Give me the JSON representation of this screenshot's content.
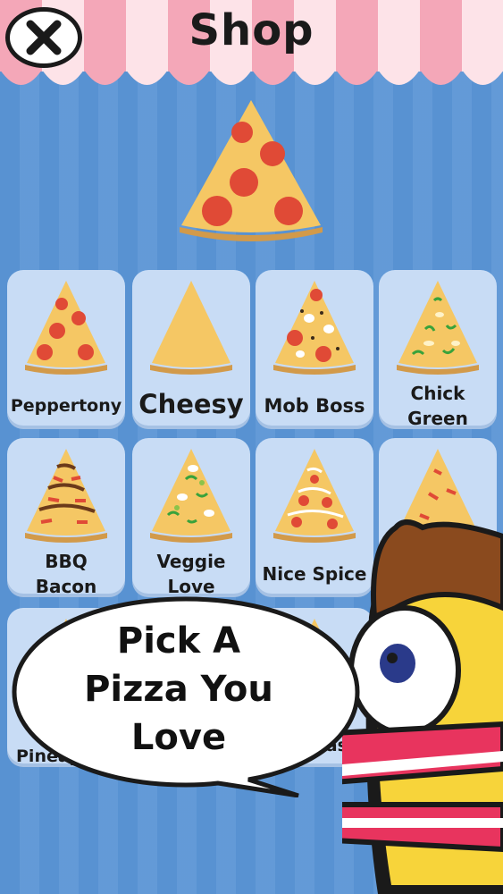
{
  "header": {
    "title": "Shop",
    "close_icon": "close-x-icon"
  },
  "hero": {
    "icon": "pepperoni-pizza-slice"
  },
  "grid": {
    "items": [
      {
        "label": "Peppertony",
        "icon": "pepperoni-pizza-slice"
      },
      {
        "label": "Cheesy",
        "icon": "cheese-pizza-slice"
      },
      {
        "label": "Mob Boss",
        "icon": "mob-boss-pizza-slice"
      },
      {
        "label_line1": "Chick",
        "label_line2": "Green",
        "icon": "chicken-green-pizza-slice"
      },
      {
        "label_line1": "BBQ",
        "label_line2": "Bacon",
        "icon": "bbq-bacon-pizza-slice"
      },
      {
        "label_line1": "Veggie",
        "label_line2": "Love",
        "icon": "veggie-pizza-slice"
      },
      {
        "label": "Nice Spice",
        "icon": "spicy-pizza-slice"
      },
      {
        "label": "",
        "icon": "pizza-slice"
      },
      {
        "label": "Pineapp",
        "icon": "pineapple-pizza-slice"
      },
      {
        "label": "kfast",
        "icon": "breakfast-pizza-slice"
      }
    ]
  },
  "speech_bubble": {
    "line1": "Pick A",
    "line2": "Pizza You",
    "line3": "Love"
  },
  "colors": {
    "background": "#5b95d4",
    "card": "#c8dcf5",
    "awning_pink": "#f6b8c4",
    "crust": "#d29a4a",
    "cheese": "#f5c764",
    "pepperoni": "#e04a36"
  }
}
